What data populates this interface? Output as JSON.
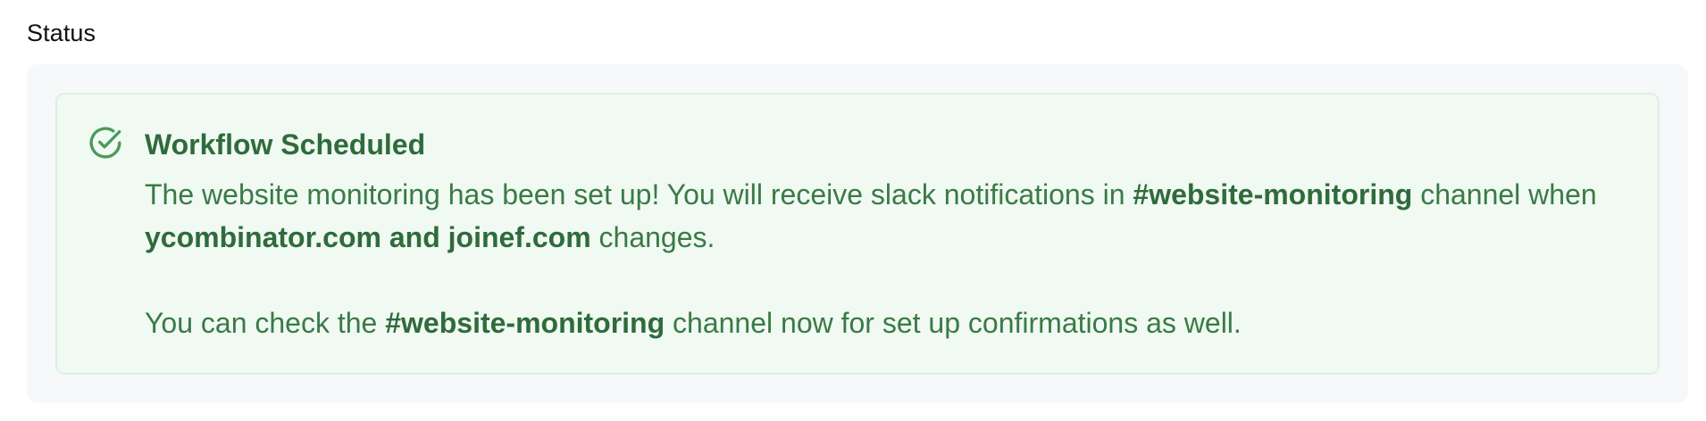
{
  "section": {
    "label": "Status"
  },
  "alert": {
    "icon": "check-circle-icon",
    "title": "Workflow Scheduled",
    "paragraph1": {
      "text1": "The website monitoring has been set up! You will receive slack notifications in ",
      "channel": "#website-monitoring",
      "text2": " channel when ",
      "sites": "ycombinator.com and joinef.com",
      "text3": " changes."
    },
    "paragraph2": {
      "text1": "You can check the ",
      "channel": "#website-monitoring",
      "text2": " channel now for set up confirmations as well."
    }
  },
  "colors": {
    "success_text": "#3a7a46",
    "success_bg": "#f0f9f2",
    "success_border": "#dcf1e1",
    "panel_bg": "#f7f8fa"
  }
}
